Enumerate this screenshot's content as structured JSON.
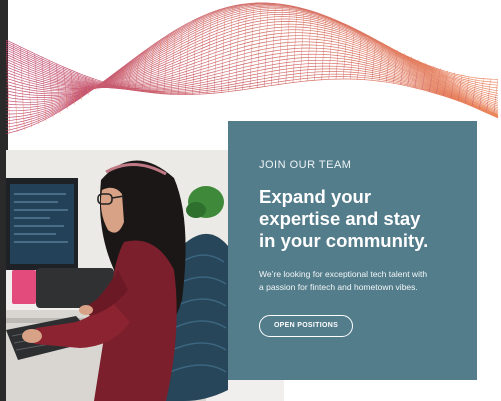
{
  "colors": {
    "panel": "#547d8c",
    "wave_start": "#b8325f",
    "wave_end": "#e9713e",
    "shirt": "#7a1f2b"
  },
  "hero": {
    "eyebrow": "JOIN OUR TEAM",
    "headline_lines": [
      "Expand your",
      "expertise and stay",
      "in your community."
    ],
    "body_lines": [
      "We’re looking for exceptional tech talent with",
      "a passion for fintech and hometown vibes."
    ],
    "cta_label": "OPEN POSITIONS"
  }
}
